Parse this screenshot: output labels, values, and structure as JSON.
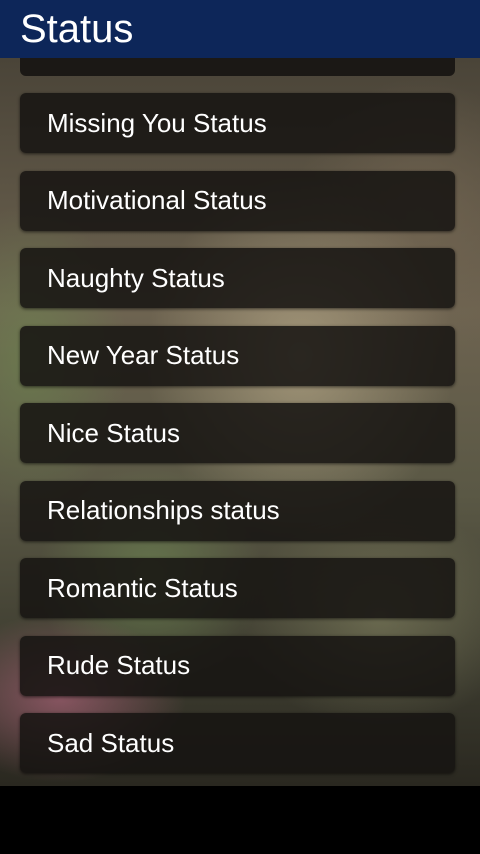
{
  "app_bar": {
    "title": "Status",
    "color": "#0d2659"
  },
  "list": {
    "items": [
      {
        "label": "Missing You Status"
      },
      {
        "label": "Motivational Status"
      },
      {
        "label": "Naughty Status"
      },
      {
        "label": "New Year Status"
      },
      {
        "label": "Nice Status"
      },
      {
        "label": "Relationships status"
      },
      {
        "label": "Romantic Status"
      },
      {
        "label": "Rude Status"
      },
      {
        "label": "Sad Status"
      }
    ]
  }
}
